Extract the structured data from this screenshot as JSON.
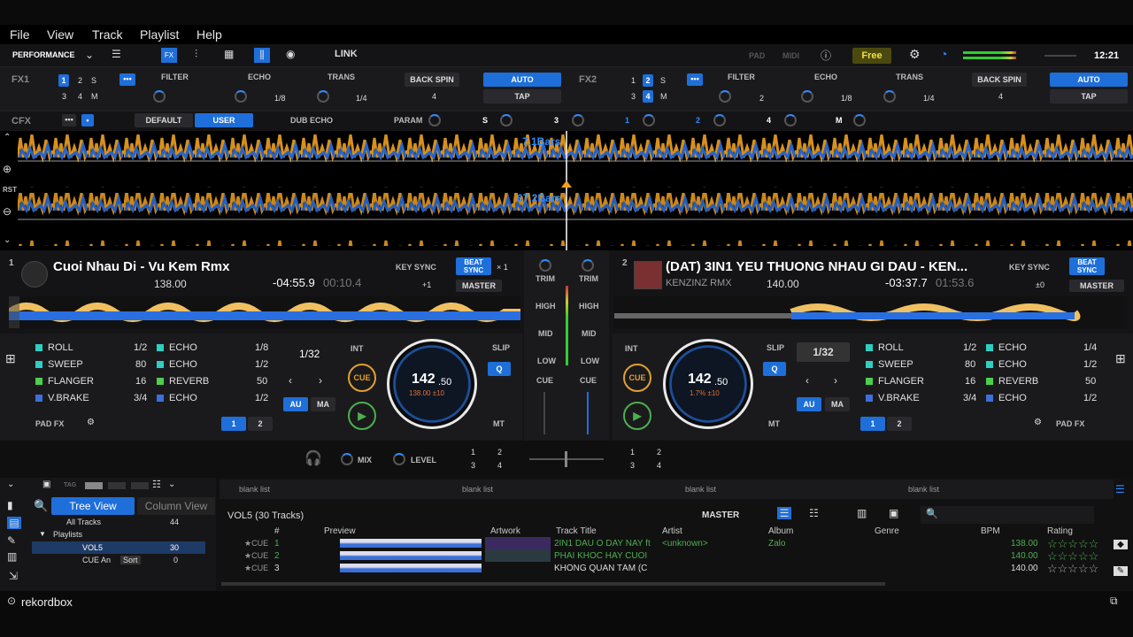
{
  "menu": [
    "File",
    "View",
    "Track",
    "Playlist",
    "Help"
  ],
  "toolbar": {
    "mode": "PERFORMANCE",
    "link": "LINK",
    "pad": "PAD",
    "midi": "MIDI",
    "plan": "Free",
    "time": "12:21"
  },
  "fx1": {
    "label": "FX1",
    "ch": [
      "1",
      "2",
      "S",
      "3",
      "4",
      "M"
    ],
    "slots": [
      "FILTER",
      "ECHO",
      "TRANS"
    ],
    "beats": [
      "1/8",
      "1/4"
    ],
    "back": "BACK SPIN",
    "auto": "AUTO",
    "tap": "TAP",
    "bpm": "4"
  },
  "fx2": {
    "label": "FX2",
    "ch": [
      "1",
      "2",
      "S",
      "3",
      "4",
      "M"
    ],
    "slots": [
      "FILTER",
      "ECHO",
      "TRANS"
    ],
    "beat0": "2",
    "beats": [
      "1/8",
      "1/4"
    ],
    "back": "BACK SPIN",
    "auto": "AUTO",
    "tap": "TAP",
    "bpm": "4"
  },
  "cfx": {
    "label": "CFX",
    "default": "DEFAULT",
    "user": "USER",
    "dub": "DUB ECHO",
    "param": "PARAM",
    "s": "S",
    "three": "3",
    "one": "1",
    "two": "2",
    "four": "4",
    "m": "M"
  },
  "wave": {
    "bars1": "7.1Bars",
    "bars2": "67.2Bars",
    "rst": "RST"
  },
  "deck1": {
    "num": "1",
    "title": "Cuoi Nhau Di - Vu Kem Rmx",
    "bpm": "138.00",
    "remain": "-04:55.9",
    "elapsed": "00:10.4",
    "keysync": "KEY SYNC",
    "beatsync": "BEAT SYNC",
    "x1": "× 1",
    "pm": "+1",
    "master": "MASTER",
    "int": "INT",
    "cue": "CUE",
    "au": "AU",
    "ma": "MA",
    "slip": "SLIP",
    "q": "Q",
    "mt": "MT",
    "loop": "1/32",
    "jog_big": "142",
    "jog_small": ".50",
    "jog_sub": "138.00 ±10",
    "padfx": "PAD FX",
    "p1": "1",
    "p2": "2"
  },
  "deck2": {
    "num": "2",
    "title": "(DAT) 3IN1 YEU THUONG NHAU GI DAU - KEN...",
    "artist": "KENZINZ RMX",
    "bpm": "140.00",
    "remain": "-03:37.7",
    "elapsed": "01:53.6",
    "keysync": "KEY SYNC",
    "beatsync": "BEAT SYNC",
    "pm": "±0",
    "master": "MASTER",
    "int": "INT",
    "cue": "CUE",
    "au": "AU",
    "ma": "MA",
    "slip": "SLIP",
    "q": "Q",
    "mt": "MT",
    "loop": "1/32",
    "jog_big": "142",
    "jog_small": ".50",
    "jog_sub": "1.7% ±10",
    "padfx": "PAD FX",
    "p1": "1",
    "p2": "2"
  },
  "pads1": [
    {
      "n": "ROLL",
      "v": "1/2",
      "c": "#2ecfc3"
    },
    {
      "n": "ECHO",
      "v": "1/8",
      "c": "#2ecfc3"
    },
    {
      "n": "SWEEP",
      "v": "80",
      "c": "#2ecfc3"
    },
    {
      "n": "ECHO",
      "v": "1/2",
      "c": "#2ecfc3"
    },
    {
      "n": "FLANGER",
      "v": "16",
      "c": "#4ccf4c"
    },
    {
      "n": "REVERB",
      "v": "50",
      "c": "#4ccf4c"
    },
    {
      "n": "V.BRAKE",
      "v": "3/4",
      "c": "#3c6fd9"
    },
    {
      "n": "ECHO",
      "v": "1/2",
      "c": "#3c6fd9"
    }
  ],
  "pads2": [
    {
      "n": "ROLL",
      "v": "1/2",
      "c": "#2ecfc3"
    },
    {
      "n": "ECHO",
      "v": "1/4",
      "c": "#2ecfc3"
    },
    {
      "n": "SWEEP",
      "v": "80",
      "c": "#2ecfc3"
    },
    {
      "n": "ECHO",
      "v": "1/2",
      "c": "#2ecfc3"
    },
    {
      "n": "FLANGER",
      "v": "16",
      "c": "#4ccf4c"
    },
    {
      "n": "REVERB",
      "v": "50",
      "c": "#4ccf4c"
    },
    {
      "n": "V.BRAKE",
      "v": "3/4",
      "c": "#3c6fd9"
    },
    {
      "n": "ECHO",
      "v": "1/2",
      "c": "#3c6fd9"
    }
  ],
  "mixer": {
    "trim": "TRIM",
    "high": "HIGH",
    "mid": "MID",
    "low": "LOW",
    "cue": "CUE",
    "mix": "MIX",
    "level": "LEVEL",
    "n1": "1",
    "n2": "2",
    "n3": "3",
    "n4": "4"
  },
  "browser": {
    "tree": "Tree View",
    "column": "Column View",
    "all": "All Tracks",
    "all_count": "44",
    "playlists": "Playlists",
    "vol5": "VOL5",
    "vol5_count": "30",
    "cue": "CUE An",
    "cue_count": "0",
    "sort": "Sort",
    "tab": "TAG",
    "lists": [
      "blank list",
      "blank list",
      "blank list",
      "blank list"
    ],
    "pl_title": "VOL5 (30 Tracks)",
    "master": "MASTER",
    "cols": [
      "#",
      "Preview",
      "Artwork",
      "Track Title",
      "Artist",
      "Album",
      "Genre",
      "BPM",
      "Rating"
    ],
    "rows": [
      {
        "tag": "★CUE",
        "n": "1",
        "title": "2IN1 DAU O DAY NAY ft",
        "artist": "<unknown>",
        "album": "Zalo",
        "bpm": "138.00"
      },
      {
        "tag": "★CUE",
        "n": "2",
        "title": "PHAI KHOC HAY CUOI",
        "artist": "",
        "album": "",
        "bpm": "140.00"
      },
      {
        "tag": "★CUE",
        "n": "3",
        "title": "KHÔNG QUAN TÂM (C",
        "artist": "",
        "album": "",
        "bpm": "140.00"
      }
    ]
  },
  "brand": "rekordbox"
}
